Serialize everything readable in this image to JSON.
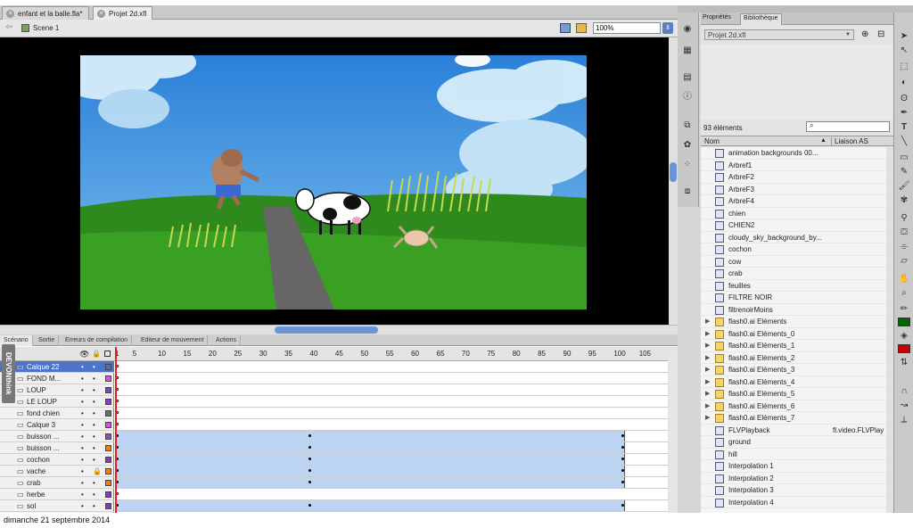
{
  "tabs": [
    {
      "label": "enfant et la balle.fla*"
    },
    {
      "label": "Projet 2d.xfl"
    }
  ],
  "scene": {
    "label": "Scene 1",
    "zoom": "100%"
  },
  "timeline": {
    "tabs": [
      "Scénario",
      "Sortie",
      "Erreurs de compilation",
      "Editeur de mouvement",
      "Actions"
    ],
    "ruler": [
      "1",
      "5",
      "10",
      "15",
      "20",
      "25",
      "30",
      "35",
      "40",
      "45",
      "50",
      "55",
      "60",
      "65",
      "70",
      "75",
      "80",
      "85",
      "90",
      "95",
      "100",
      "105"
    ],
    "layers": [
      {
        "name": "Calque 22",
        "color": "#4a6fd0"
      },
      {
        "name": "FOND M...",
        "color": "#e050e0"
      },
      {
        "name": "LOUP",
        "color": "#8a3ad0"
      },
      {
        "name": "LE LOUP",
        "color": "#8a3ad0"
      },
      {
        "name": "fond chien",
        "color": "#6f6f6f"
      },
      {
        "name": "Calque 3",
        "color": "#e050e0"
      },
      {
        "name": "buisson ...",
        "color": "#a040d0"
      },
      {
        "name": "buisson ...",
        "color": "#ff7a00"
      },
      {
        "name": "cochon",
        "color": "#9030d0"
      },
      {
        "name": "vache",
        "color": "#ff7a00"
      },
      {
        "name": "crab",
        "color": "#ff7a00"
      },
      {
        "name": "herbe",
        "color": "#9030d0"
      },
      {
        "name": "sol",
        "color": "#9030d0"
      }
    ]
  },
  "library": {
    "panel_tabs": [
      "Propriétés",
      "Bibliothèque"
    ],
    "document": "Projet 2d.xfl",
    "count": "93 éléments",
    "col_name": "Nom",
    "col_link": "Liaison AS",
    "items": [
      {
        "name": "animation backgrounds 00...",
        "link": "",
        "folder": false
      },
      {
        "name": "Arbref1",
        "link": "",
        "folder": false
      },
      {
        "name": "ArbreF2",
        "link": "",
        "folder": false
      },
      {
        "name": "ArbreF3",
        "link": "",
        "folder": false
      },
      {
        "name": "ArbreF4",
        "link": "",
        "folder": false
      },
      {
        "name": "chien",
        "link": "",
        "folder": false
      },
      {
        "name": "CHIEN2",
        "link": "",
        "folder": false
      },
      {
        "name": "cloudy_sky_background_by...",
        "link": "",
        "folder": false
      },
      {
        "name": "cochon",
        "link": "",
        "folder": false
      },
      {
        "name": "cow",
        "link": "",
        "folder": false
      },
      {
        "name": "crab",
        "link": "",
        "folder": false
      },
      {
        "name": "feuilles",
        "link": "",
        "folder": false
      },
      {
        "name": "FILTRE NOIR",
        "link": "",
        "folder": false
      },
      {
        "name": "filtrenoirMoins",
        "link": "",
        "folder": false
      },
      {
        "name": "flash0.ai Eléments",
        "link": "",
        "folder": true
      },
      {
        "name": "flash0.ai Eléments_0",
        "link": "",
        "folder": true
      },
      {
        "name": "flash0.ai Eléments_1",
        "link": "",
        "folder": true
      },
      {
        "name": "flash0.ai Eléments_2",
        "link": "",
        "folder": true
      },
      {
        "name": "flash0.ai Eléments_3",
        "link": "",
        "folder": true
      },
      {
        "name": "flash0.ai Eléments_4",
        "link": "",
        "folder": true
      },
      {
        "name": "flash0.ai Eléments_5",
        "link": "",
        "folder": true
      },
      {
        "name": "flash0.ai Eléments_6",
        "link": "",
        "folder": true
      },
      {
        "name": "flash0.ai Eléments_7",
        "link": "",
        "folder": true
      },
      {
        "name": "FLVPlayback",
        "link": "fl.video.FLVPlay",
        "folder": false
      },
      {
        "name": "ground",
        "link": "",
        "folder": false
      },
      {
        "name": "hill",
        "link": "",
        "folder": false
      },
      {
        "name": "Interpolation 1",
        "link": "",
        "folder": false
      },
      {
        "name": "Interpolation 2",
        "link": "",
        "folder": false
      },
      {
        "name": "Interpolation 3",
        "link": "",
        "folder": false
      },
      {
        "name": "Interpolation 4",
        "link": "",
        "folder": false
      }
    ]
  },
  "watermark": "DEVONthink",
  "date": "dimanche 21 septembre 2014",
  "colors": {
    "stroke": "#006600",
    "fill": "#cc0000"
  }
}
